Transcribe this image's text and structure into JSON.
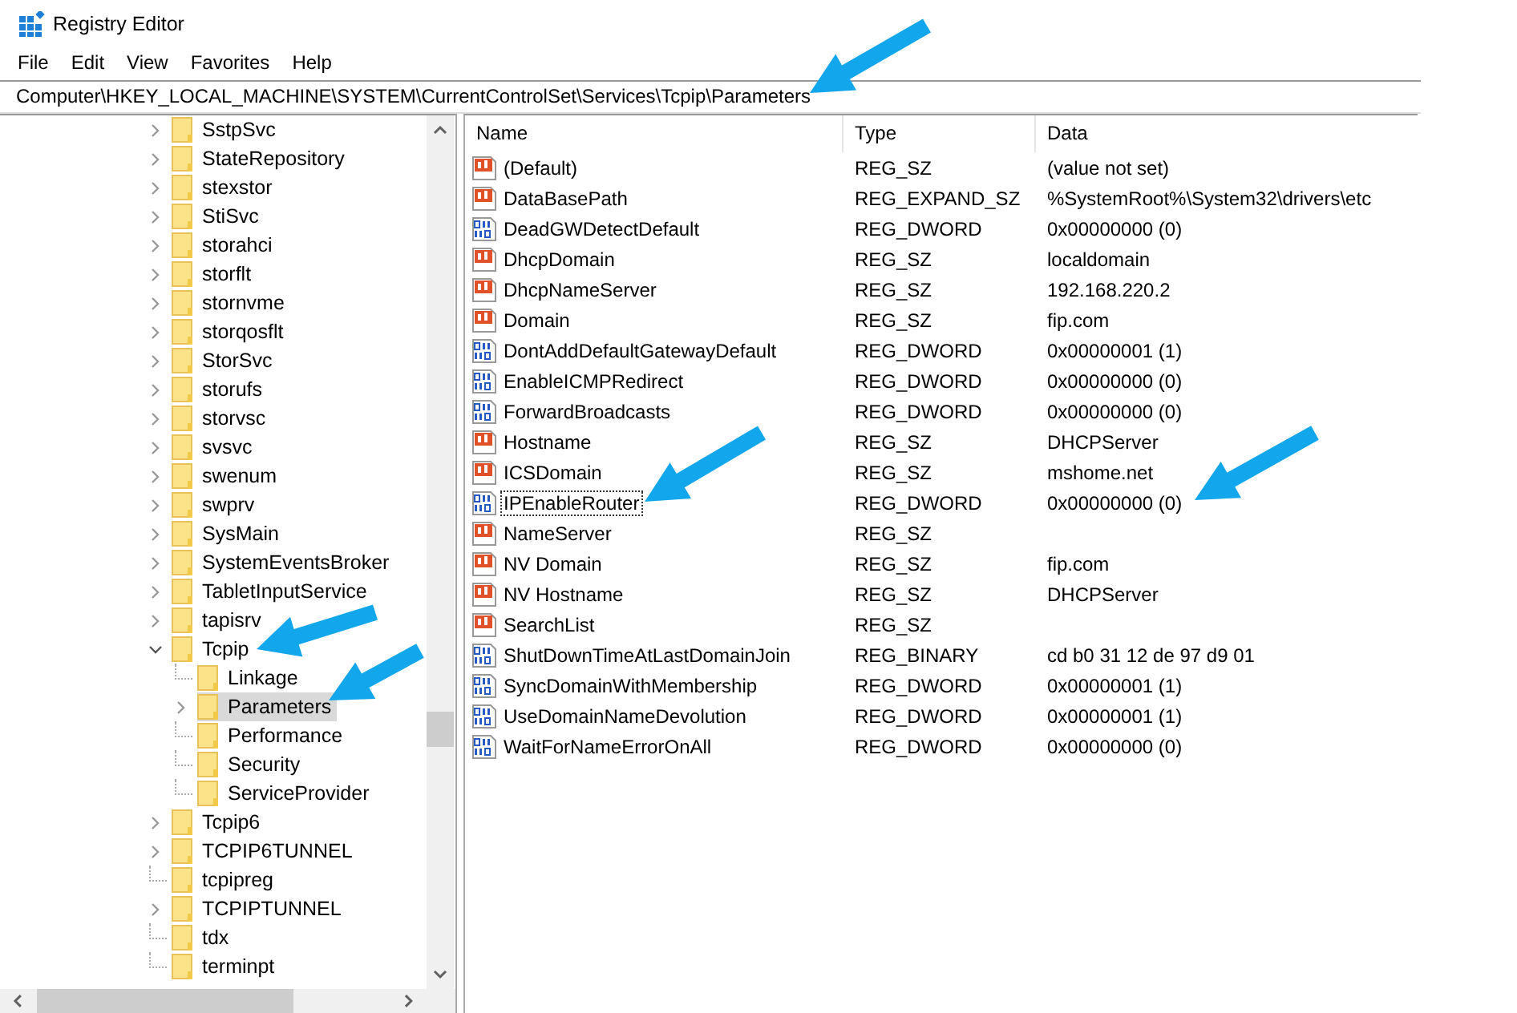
{
  "window": {
    "title": "Registry Editor"
  },
  "menu": [
    "File",
    "Edit",
    "View",
    "Favorites",
    "Help"
  ],
  "address": "Computer\\HKEY_LOCAL_MACHINE\\SYSTEM\\CurrentControlSet\\Services\\Tcpip\\Parameters",
  "tree": [
    {
      "label": "SstpSvc",
      "expandable": true,
      "selected": false
    },
    {
      "label": "StateRepository",
      "expandable": true,
      "selected": false
    },
    {
      "label": "stexstor",
      "expandable": true,
      "selected": false
    },
    {
      "label": "StiSvc",
      "expandable": true,
      "selected": false
    },
    {
      "label": "storahci",
      "expandable": true,
      "selected": false
    },
    {
      "label": "storflt",
      "expandable": true,
      "selected": false
    },
    {
      "label": "stornvme",
      "expandable": true,
      "selected": false
    },
    {
      "label": "storqosflt",
      "expandable": true,
      "selected": false
    },
    {
      "label": "StorSvc",
      "expandable": true,
      "selected": false
    },
    {
      "label": "storufs",
      "expandable": true,
      "selected": false
    },
    {
      "label": "storvsc",
      "expandable": true,
      "selected": false
    },
    {
      "label": "svsvc",
      "expandable": true,
      "selected": false
    },
    {
      "label": "swenum",
      "expandable": true,
      "selected": false
    },
    {
      "label": "swprv",
      "expandable": true,
      "selected": false
    },
    {
      "label": "SysMain",
      "expandable": true,
      "selected": false
    },
    {
      "label": "SystemEventsBroker",
      "expandable": true,
      "selected": false
    },
    {
      "label": "TabletInputService",
      "expandable": true,
      "selected": false
    },
    {
      "label": "tapisrv",
      "expandable": true,
      "selected": false
    },
    {
      "label": "Tcpip",
      "expandable": true,
      "expanded": true,
      "selected": false,
      "children": [
        {
          "label": "Linkage",
          "expandable": false,
          "selected": false
        },
        {
          "label": "Parameters",
          "expandable": true,
          "selected": true
        },
        {
          "label": "Performance",
          "expandable": false,
          "selected": false
        },
        {
          "label": "Security",
          "expandable": false,
          "selected": false
        },
        {
          "label": "ServiceProvider",
          "expandable": false,
          "selected": false
        }
      ]
    },
    {
      "label": "Tcpip6",
      "expandable": true,
      "selected": false
    },
    {
      "label": "TCPIP6TUNNEL",
      "expandable": true,
      "selected": false
    },
    {
      "label": "tcpipreg",
      "expandable": false,
      "selected": false
    },
    {
      "label": "TCPIPTUNNEL",
      "expandable": true,
      "selected": false
    },
    {
      "label": "tdx",
      "expandable": false,
      "selected": false
    },
    {
      "label": "terminpt",
      "expandable": false,
      "selected": false
    }
  ],
  "table": {
    "columns": [
      "Name",
      "Type",
      "Data"
    ],
    "rows": [
      {
        "kind": "string",
        "name": "(Default)",
        "type": "REG_SZ",
        "data": "(value not set)",
        "focused": false
      },
      {
        "kind": "string",
        "name": "DataBasePath",
        "type": "REG_EXPAND_SZ",
        "data": "%SystemRoot%\\System32\\drivers\\etc",
        "focused": false
      },
      {
        "kind": "binary",
        "name": "DeadGWDetectDefault",
        "type": "REG_DWORD",
        "data": "0x00000000 (0)",
        "focused": false
      },
      {
        "kind": "string",
        "name": "DhcpDomain",
        "type": "REG_SZ",
        "data": "localdomain",
        "focused": false
      },
      {
        "kind": "string",
        "name": "DhcpNameServer",
        "type": "REG_SZ",
        "data": "192.168.220.2",
        "focused": false
      },
      {
        "kind": "string",
        "name": "Domain",
        "type": "REG_SZ",
        "data": "fip.com",
        "focused": false
      },
      {
        "kind": "binary",
        "name": "DontAddDefaultGatewayDefault",
        "type": "REG_DWORD",
        "data": "0x00000001 (1)",
        "focused": false
      },
      {
        "kind": "binary",
        "name": "EnableICMPRedirect",
        "type": "REG_DWORD",
        "data": "0x00000000 (0)",
        "focused": false
      },
      {
        "kind": "binary",
        "name": "ForwardBroadcasts",
        "type": "REG_DWORD",
        "data": "0x00000000 (0)",
        "focused": false
      },
      {
        "kind": "string",
        "name": "Hostname",
        "type": "REG_SZ",
        "data": "DHCPServer",
        "focused": false
      },
      {
        "kind": "string",
        "name": "ICSDomain",
        "type": "REG_SZ",
        "data": "mshome.net",
        "focused": false
      },
      {
        "kind": "binary",
        "name": "IPEnableRouter",
        "type": "REG_DWORD",
        "data": "0x00000000 (0)",
        "focused": true
      },
      {
        "kind": "string",
        "name": "NameServer",
        "type": "REG_SZ",
        "focused": false
      },
      {
        "kind": "string",
        "name": "NV Domain",
        "type": "REG_SZ",
        "data": "fip.com",
        "focused": false
      },
      {
        "kind": "string",
        "name": "NV Hostname",
        "type": "REG_SZ",
        "data": "DHCPServer",
        "focused": false
      },
      {
        "kind": "string",
        "name": "SearchList",
        "type": "REG_SZ",
        "focused": false
      },
      {
        "kind": "binary",
        "name": "ShutDownTimeAtLastDomainJoin",
        "type": "REG_BINARY",
        "data": "cd b0 31 12 de 97 d9 01",
        "focused": false
      },
      {
        "kind": "binary",
        "name": "SyncDomainWithMembership",
        "type": "REG_DWORD",
        "data": "0x00000001 (1)",
        "focused": false
      },
      {
        "kind": "binary",
        "name": "UseDomainNameDevolution",
        "type": "REG_DWORD",
        "data": "0x00000001 (1)",
        "focused": false
      },
      {
        "kind": "binary",
        "name": "WaitForNameErrorOnAll",
        "type": "REG_DWORD",
        "data": "0x00000000 (0)",
        "focused": false
      }
    ]
  }
}
